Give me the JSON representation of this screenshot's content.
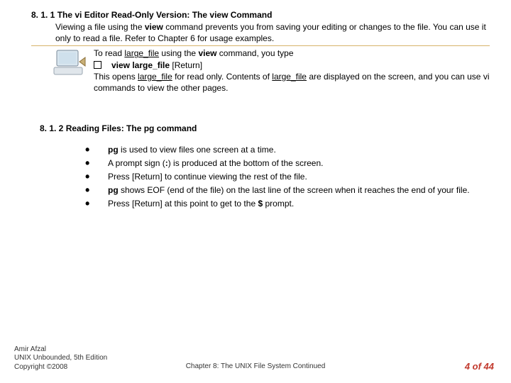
{
  "section1": {
    "heading_pre": "8. 1. 1 The vi Editor Read-Only Version: The ",
    "heading_cmd": "view",
    "heading_post": " Command",
    "p1a": "Viewing a file using the ",
    "p1b": "view",
    "p1c": " command prevents you from saving your editing or changes to the file. You can use it only to read a file. Refer to Chapter 6 for usage examples.",
    "line1a": "To read ",
    "line1_file": "large_file",
    "line1b": " using the ",
    "line1_cmd": "view",
    "line1c": " command, you type",
    "cmd_bold": "view large_file",
    "cmd_return": " [Return]",
    "line3a": "This opens ",
    "line3b": " for read only. Contents of ",
    "line3c": " are displayed on the screen, and you can use vi commands to view the other pages."
  },
  "section2": {
    "heading": "8. 1. 2 Reading Files: The pg command",
    "b1_cmd": "pg",
    "b1_text": " is used to view files one screen at a time.",
    "b2a": "A prompt sign (",
    "b2_colon": ":",
    "b2b": ") is produced at the bottom of the screen.",
    "b3": "Press [Return] to continue viewing the rest of the file.",
    "b4_cmd": "pg",
    "b4_text": " shows EOF (end of the file) on the last line of the screen when it reaches the end of your file.",
    "b5a": "Press [Return] at this point to get to the ",
    "b5_dollar": "$",
    "b5b": " prompt."
  },
  "footer": {
    "author": "Amir Afzal",
    "book": "UNIX Unbounded, 5th Edition",
    "copyright": "Copyright ©2008",
    "chapter": "Chapter 8: The UNIX File System Continued",
    "page": "4 of 44"
  }
}
